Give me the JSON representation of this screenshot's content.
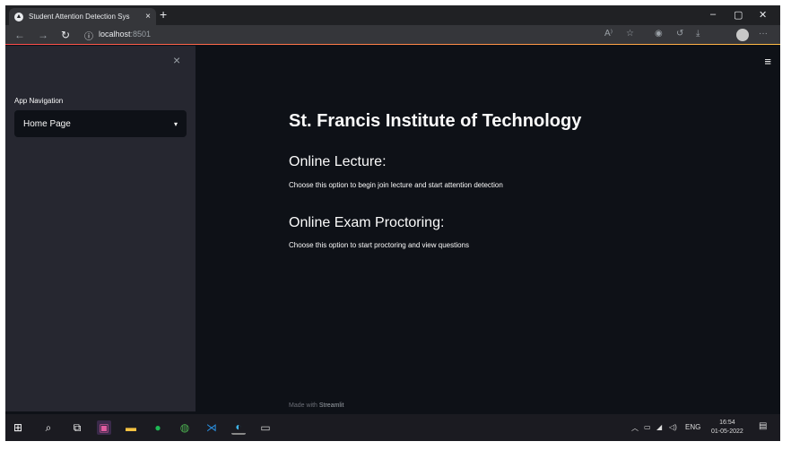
{
  "browser": {
    "tab_title": "Student Attention Detection Sys",
    "tab_close": "×",
    "new_tab": "+",
    "url_host": "localhost",
    "url_port": ":8501",
    "controls": {
      "minimize": "–",
      "maximize": "▢",
      "close": "✕"
    }
  },
  "sidebar": {
    "close_glyph": "×",
    "nav_label": "App Navigation",
    "select_value": "Home Page"
  },
  "main": {
    "title": "St. Francis Institute of Technology",
    "section1_title": "Online Lecture:",
    "section1_text": "Choose this option to begin join lecture and start attention detection",
    "section2_title": "Online Exam Proctoring:",
    "section2_text": "Choose this option to start proctoring and view questions",
    "footer_prefix": "Made with ",
    "footer_brand": "Streamlit"
  },
  "taskbar": {
    "lang": "ENG",
    "time": "16:54",
    "date": "01-05-2022"
  },
  "colors": {
    "accent": "#ff4b4b",
    "sidebar_bg": "#262730",
    "main_bg": "#0e1117"
  }
}
